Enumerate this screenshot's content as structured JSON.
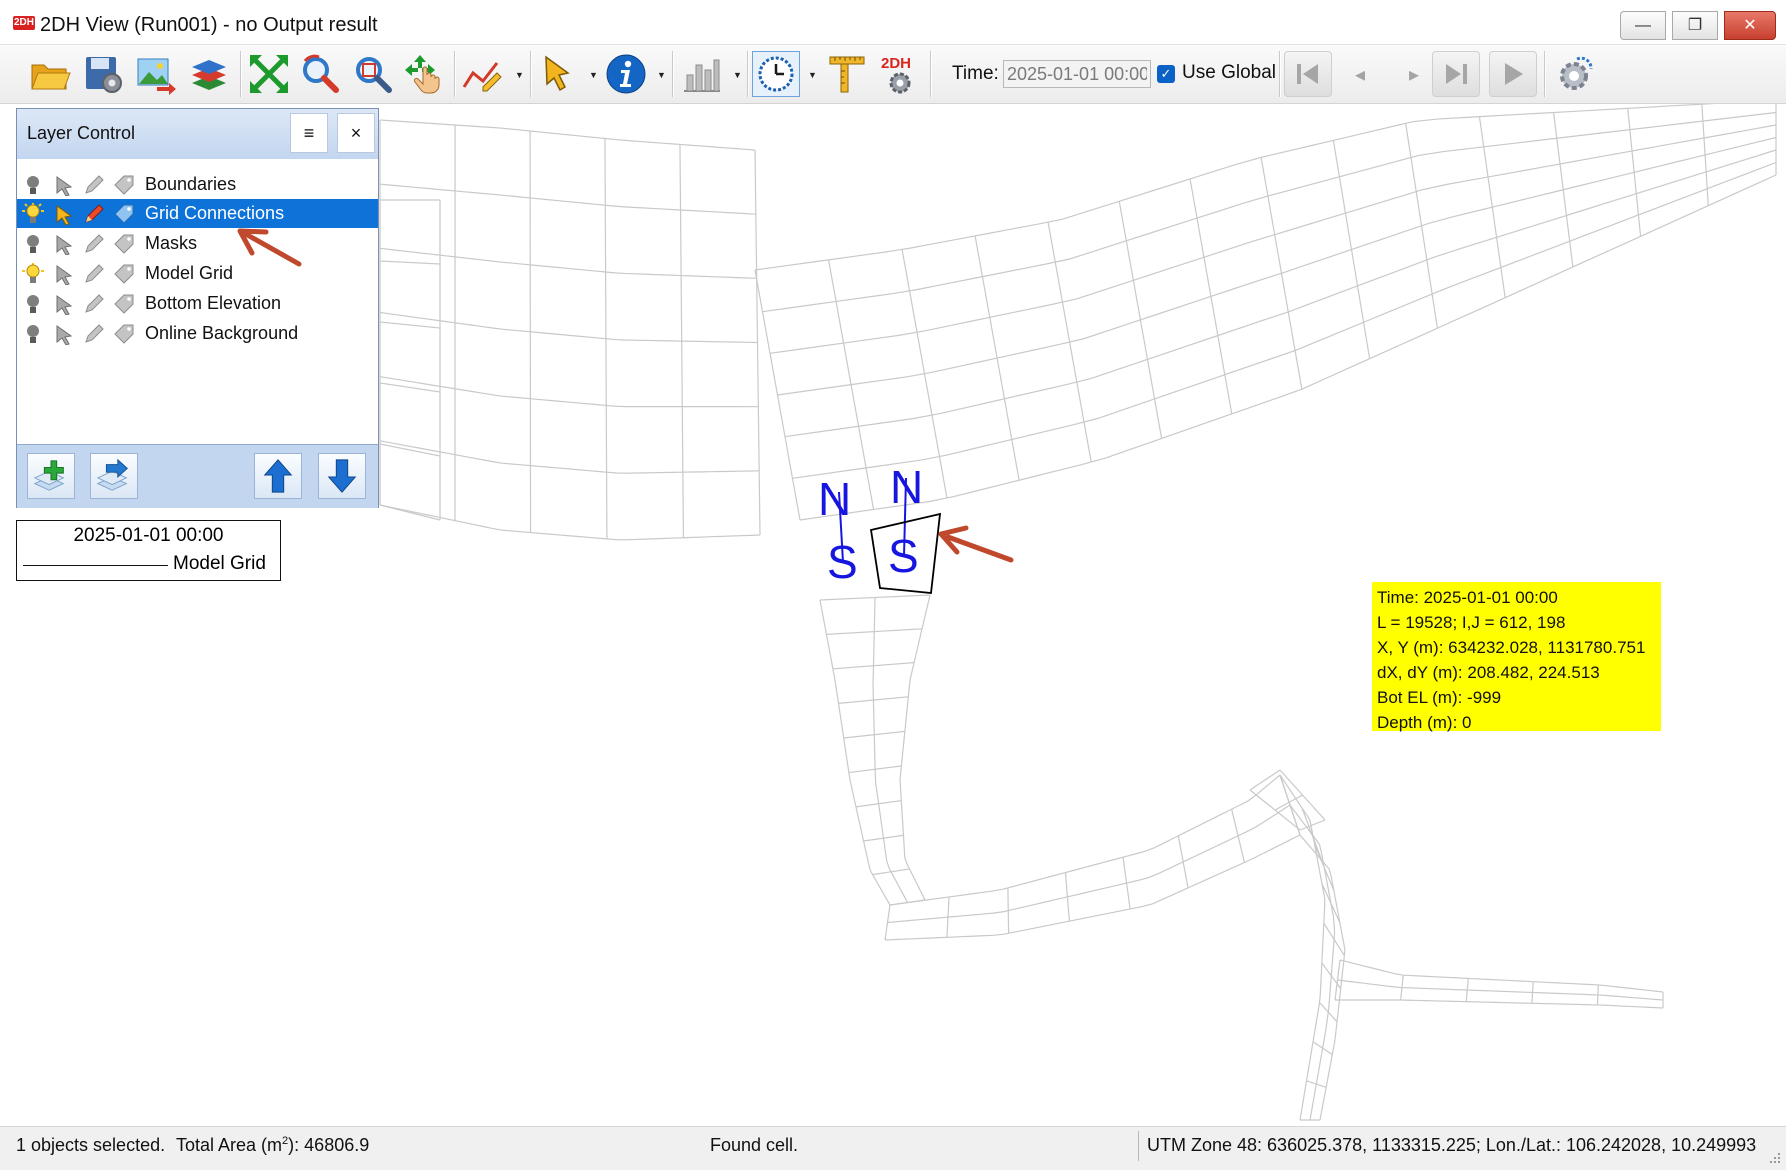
{
  "window": {
    "app_icon_text": "2DH",
    "title": "2DH View (Run001) - no Output result",
    "minimize_glyph": "—",
    "maximize_glyph": "❐",
    "close_glyph": "✕"
  },
  "toolbar": {
    "buttons": [
      {
        "name": "open-folder-icon"
      },
      {
        "name": "settings-save-icon"
      },
      {
        "name": "export-image-icon"
      },
      {
        "name": "layers-icon"
      },
      {
        "name": "zoom-extents-icon"
      },
      {
        "name": "zoom-previous-icon"
      },
      {
        "name": "zoom-window-icon"
      },
      {
        "name": "pan-icon"
      },
      {
        "name": "polyline-tool-icon"
      },
      {
        "name": "select-pointer-icon"
      },
      {
        "name": "info-icon"
      },
      {
        "name": "chart-icon"
      },
      {
        "name": "clock-icon"
      },
      {
        "name": "ruler-icon"
      },
      {
        "name": "2dh-settings-icon"
      }
    ],
    "time_label": "Time:",
    "time_value": "2025-01-01 00:00",
    "use_global_label": "Use Global",
    "use_global_checked": true,
    "nav": [
      "first-frame-icon",
      "previous-frame-icon",
      "next-frame-icon",
      "last-frame-icon",
      "play-icon",
      "animation-settings-icon"
    ],
    "prev_glyph": "◂",
    "next_glyph": "▸"
  },
  "layer_control": {
    "title": "Layer Control",
    "menu_glyph": "≡",
    "close_glyph": "×",
    "layers": [
      {
        "label": "Boundaries",
        "selected": false,
        "visible": false
      },
      {
        "label": "Grid Connections",
        "selected": true,
        "visible": true
      },
      {
        "label": "Masks",
        "selected": false,
        "visible": false
      },
      {
        "label": "Model Grid",
        "selected": false,
        "visible": true
      },
      {
        "label": "Bottom Elevation",
        "selected": false,
        "visible": false
      },
      {
        "label": "Online Background",
        "selected": false,
        "visible": false
      }
    ],
    "footer_buttons": [
      "add-layer-icon",
      "export-layer-icon",
      "move-up-icon",
      "move-down-icon"
    ]
  },
  "legend": {
    "time": "2025-01-01 00:00",
    "label": "Model Grid"
  },
  "info_box": {
    "lines": [
      "Time: 2025-01-01 00:00",
      "L = 19528; I,J = 612, 198",
      "X, Y (m): 634232.028, 1131780.751",
      "dX, dY (m): 208.482, 224.513",
      "Bot EL  (m): -999",
      "Depth  (m): 0"
    ]
  },
  "map": {
    "north_letter": "N",
    "south_letter": "S",
    "grid_color": "#c9c9c9",
    "marker_color": "#1616e0",
    "arrow_color": "#c0482c",
    "highlight_color": "#000000"
  },
  "status": {
    "selected": "1 objects selected.",
    "area_prefix": "Total Area (m",
    "area_superscript": "2",
    "area_suffix": "): 46806.9",
    "found": "Found cell.",
    "coords": "UTM Zone 48: 636025.378, 1133315.225; Lon./Lat.: 106.242028, 10.249993"
  }
}
